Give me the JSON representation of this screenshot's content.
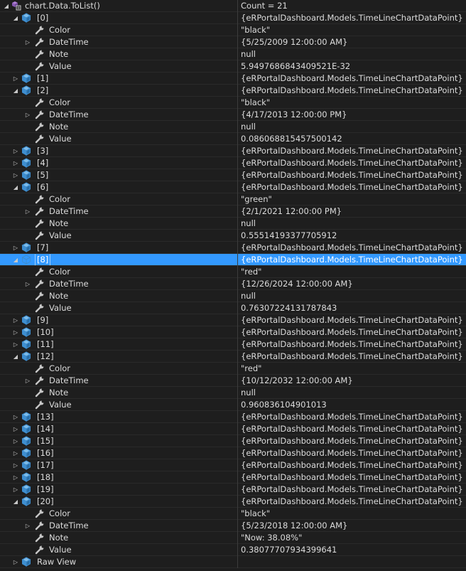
{
  "root": {
    "name": "chart.Data.ToList()",
    "value": "Count = 21"
  },
  "item_type": "{eRPortalDashboard.Models.TimeLineChartDataPoint}",
  "property_labels": {
    "color": "Color",
    "datetime": "DateTime",
    "note": "Note",
    "value": "Value"
  },
  "items": [
    {
      "index": "[0]",
      "expanded": true,
      "color": "\"black\"",
      "datetime": "{5/25/2009 12:00:00 AM}",
      "note": "null",
      "value": "5.9497686843409521E-32"
    },
    {
      "index": "[1]",
      "expanded": false
    },
    {
      "index": "[2]",
      "expanded": true,
      "color": "\"black\"",
      "datetime": "{4/17/2013 12:00:00 PM}",
      "note": "null",
      "value": "0.086068815457500142"
    },
    {
      "index": "[3]",
      "expanded": false
    },
    {
      "index": "[4]",
      "expanded": false
    },
    {
      "index": "[5]",
      "expanded": false
    },
    {
      "index": "[6]",
      "expanded": true,
      "color": "\"green\"",
      "datetime": "{2/1/2021 12:00:00 PM}",
      "note": "null",
      "value": "0.55514193377705912"
    },
    {
      "index": "[7]",
      "expanded": false
    },
    {
      "index": "[8]",
      "expanded": true,
      "selected": true,
      "color": "\"red\"",
      "datetime": "{12/26/2024 12:00:00 AM}",
      "note": "null",
      "value": "0.76307224131787843"
    },
    {
      "index": "[9]",
      "expanded": false
    },
    {
      "index": "[10]",
      "expanded": false
    },
    {
      "index": "[11]",
      "expanded": false
    },
    {
      "index": "[12]",
      "expanded": true,
      "color": "\"red\"",
      "datetime": "{10/12/2032 12:00:00 AM}",
      "note": "null",
      "value": "0.960836104901013"
    },
    {
      "index": "[13]",
      "expanded": false
    },
    {
      "index": "[14]",
      "expanded": false
    },
    {
      "index": "[15]",
      "expanded": false
    },
    {
      "index": "[16]",
      "expanded": false
    },
    {
      "index": "[17]",
      "expanded": false
    },
    {
      "index": "[18]",
      "expanded": false
    },
    {
      "index": "[19]",
      "expanded": false
    },
    {
      "index": "[20]",
      "expanded": true,
      "color": "\"black\"",
      "datetime": "{5/23/2018 12:00:00 AM}",
      "note": "\"Now: 38.08%\"",
      "value": "0.38077707934399641"
    }
  ],
  "raw_view": {
    "name": "Raw View"
  },
  "icons": {
    "root": "watch-method-icon",
    "item": "object-cube-icon",
    "property": "wrench-property-icon",
    "expanded": "expanded-triangle",
    "collapsed": "collapsed-triangle",
    "child_collapsed": "child-collapsed-triangle"
  },
  "glyphs": {
    "expanded": "◢",
    "collapsed": "▷"
  },
  "colors": {
    "background": "#1e1e1e",
    "selection": "#3399ff",
    "text": "#dcdcdc",
    "cube": "#3e8ed0",
    "wrench": "#c8c8c8"
  }
}
